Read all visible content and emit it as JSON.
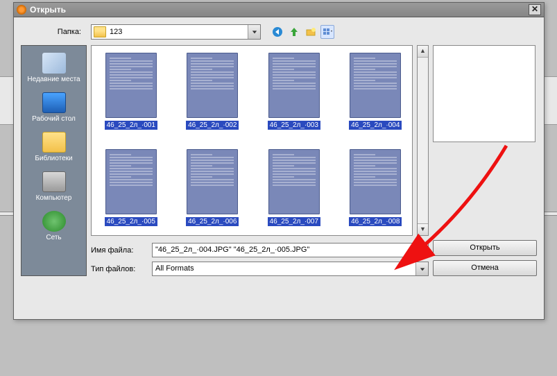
{
  "window": {
    "title": "Открыть"
  },
  "toolbar": {
    "folder_label": "Папка:",
    "folder_value": "123"
  },
  "places": [
    {
      "label": "Недавние места",
      "icon": "recent"
    },
    {
      "label": "Рабочий стол",
      "icon": "desktop"
    },
    {
      "label": "Библиотеки",
      "icon": "libraries"
    },
    {
      "label": "Компьютер",
      "icon": "computer"
    },
    {
      "label": "Сеть",
      "icon": "network"
    }
  ],
  "files": [
    {
      "name": "46_25_2л_·001"
    },
    {
      "name": "46_25_2л_·002"
    },
    {
      "name": "46_25_2л_·003"
    },
    {
      "name": "46_25_2л_·004"
    },
    {
      "name": "46_25_2л_·005"
    },
    {
      "name": "46_25_2л_·006"
    },
    {
      "name": "46_25_2л_·007"
    },
    {
      "name": "46_25_2л_·008"
    }
  ],
  "inputs": {
    "filename_label": "Имя файла:",
    "filename_value": "\"46_25_2л_·004.JPG\" \"46_25_2л_·005.JPG\"",
    "filetype_label": "Тип файлов:",
    "filetype_value": "All Formats"
  },
  "buttons": {
    "open": "Открыть",
    "cancel": "Отмена"
  }
}
